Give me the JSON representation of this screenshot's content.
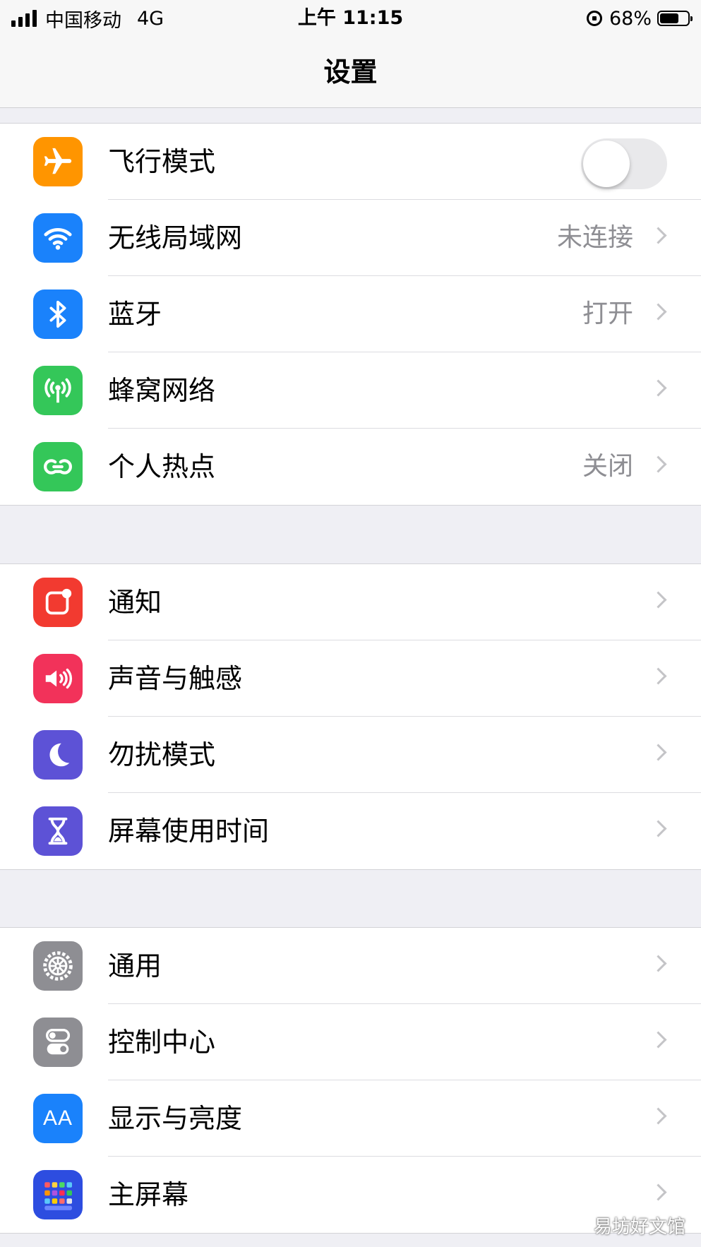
{
  "status_bar": {
    "carrier": "中国移动",
    "network": "4G",
    "time": "上午 11:15",
    "battery": "68%",
    "battery_level": 0.68
  },
  "nav": {
    "title": "设置"
  },
  "groups": [
    {
      "items": [
        {
          "label": "飞行模式",
          "icon": "airplane-icon",
          "icon_color": "#ff9500",
          "toggle": "off"
        },
        {
          "label": "无线局域网",
          "value": "未连接",
          "icon": "wifi-icon",
          "icon_color": "#1a82fb"
        },
        {
          "label": "蓝牙",
          "value": "打开",
          "icon": "bluetooth-icon",
          "icon_color": "#1a82fb"
        },
        {
          "label": "蜂窝网络",
          "icon": "cellular-icon",
          "icon_color": "#34c759"
        },
        {
          "label": "个人热点",
          "value": "关闭",
          "icon": "hotspot-icon",
          "icon_color": "#34c759"
        }
      ]
    },
    {
      "items": [
        {
          "label": "通知",
          "icon": "notification-icon",
          "icon_color": "#f23a30"
        },
        {
          "label": "声音与触感",
          "icon": "speaker-icon",
          "icon_color": "#f2325a"
        },
        {
          "label": "勿扰模式",
          "icon": "moon-icon",
          "icon_color": "#5d52d6"
        },
        {
          "label": "屏幕使用时间",
          "icon": "hourglass-icon",
          "icon_color": "#5d52d6"
        }
      ]
    },
    {
      "items": [
        {
          "label": "通用",
          "icon": "gear-icon",
          "icon_color": "#8e8e93"
        },
        {
          "label": "控制中心",
          "icon": "switches-icon",
          "icon_color": "#8e8e93"
        },
        {
          "label": "显示与亮度",
          "icon": "display-text-icon",
          "icon_text": "AA",
          "icon_color": "#1a82fb"
        },
        {
          "label": "主屏幕",
          "icon": "home-grid-icon",
          "icon_color": "#2d4de0"
        }
      ]
    }
  ],
  "watermark": "易坊好文馆"
}
